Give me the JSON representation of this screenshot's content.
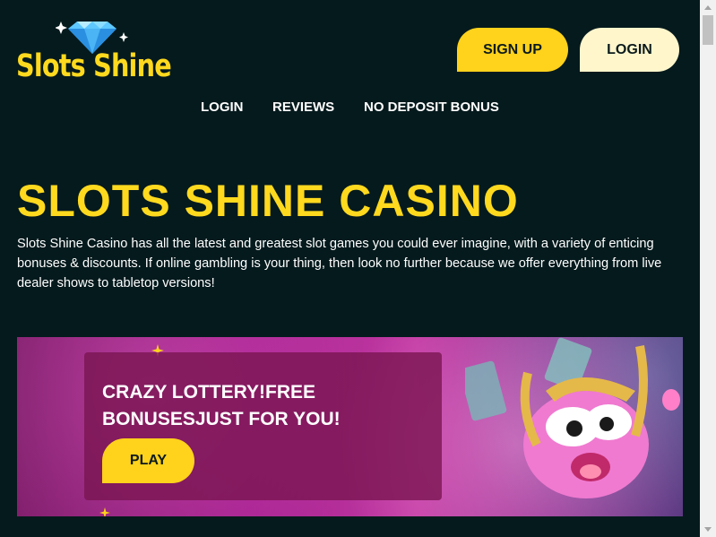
{
  "header": {
    "logo_text": "Slots Shine",
    "signup_label": "SIGN UP",
    "login_label": "LOGIN"
  },
  "nav": {
    "items": [
      "LOGIN",
      "REVIEWS",
      "NO DEPOSIT BONUS"
    ]
  },
  "hero": {
    "title": "SLOTS SHINE CASINO",
    "description": "Slots Shine Casino has all the latest and greatest slot games you could ever imagine, with a variety of enticing bonuses & discounts. If online gambling is your thing, then look no further because we offer everything from live dealer shows to tabletop versions!"
  },
  "banner": {
    "headline": "CRAZY LOTTERY!FREE BONUSESJUST FOR YOU!",
    "play_label": "PLAY",
    "mascot_icon": "pig-mascot-icon"
  },
  "colors": {
    "background": "#051a1d",
    "accent": "#ffd91e",
    "login_button": "#fff6cc",
    "banner_purple": "#a5208f"
  }
}
